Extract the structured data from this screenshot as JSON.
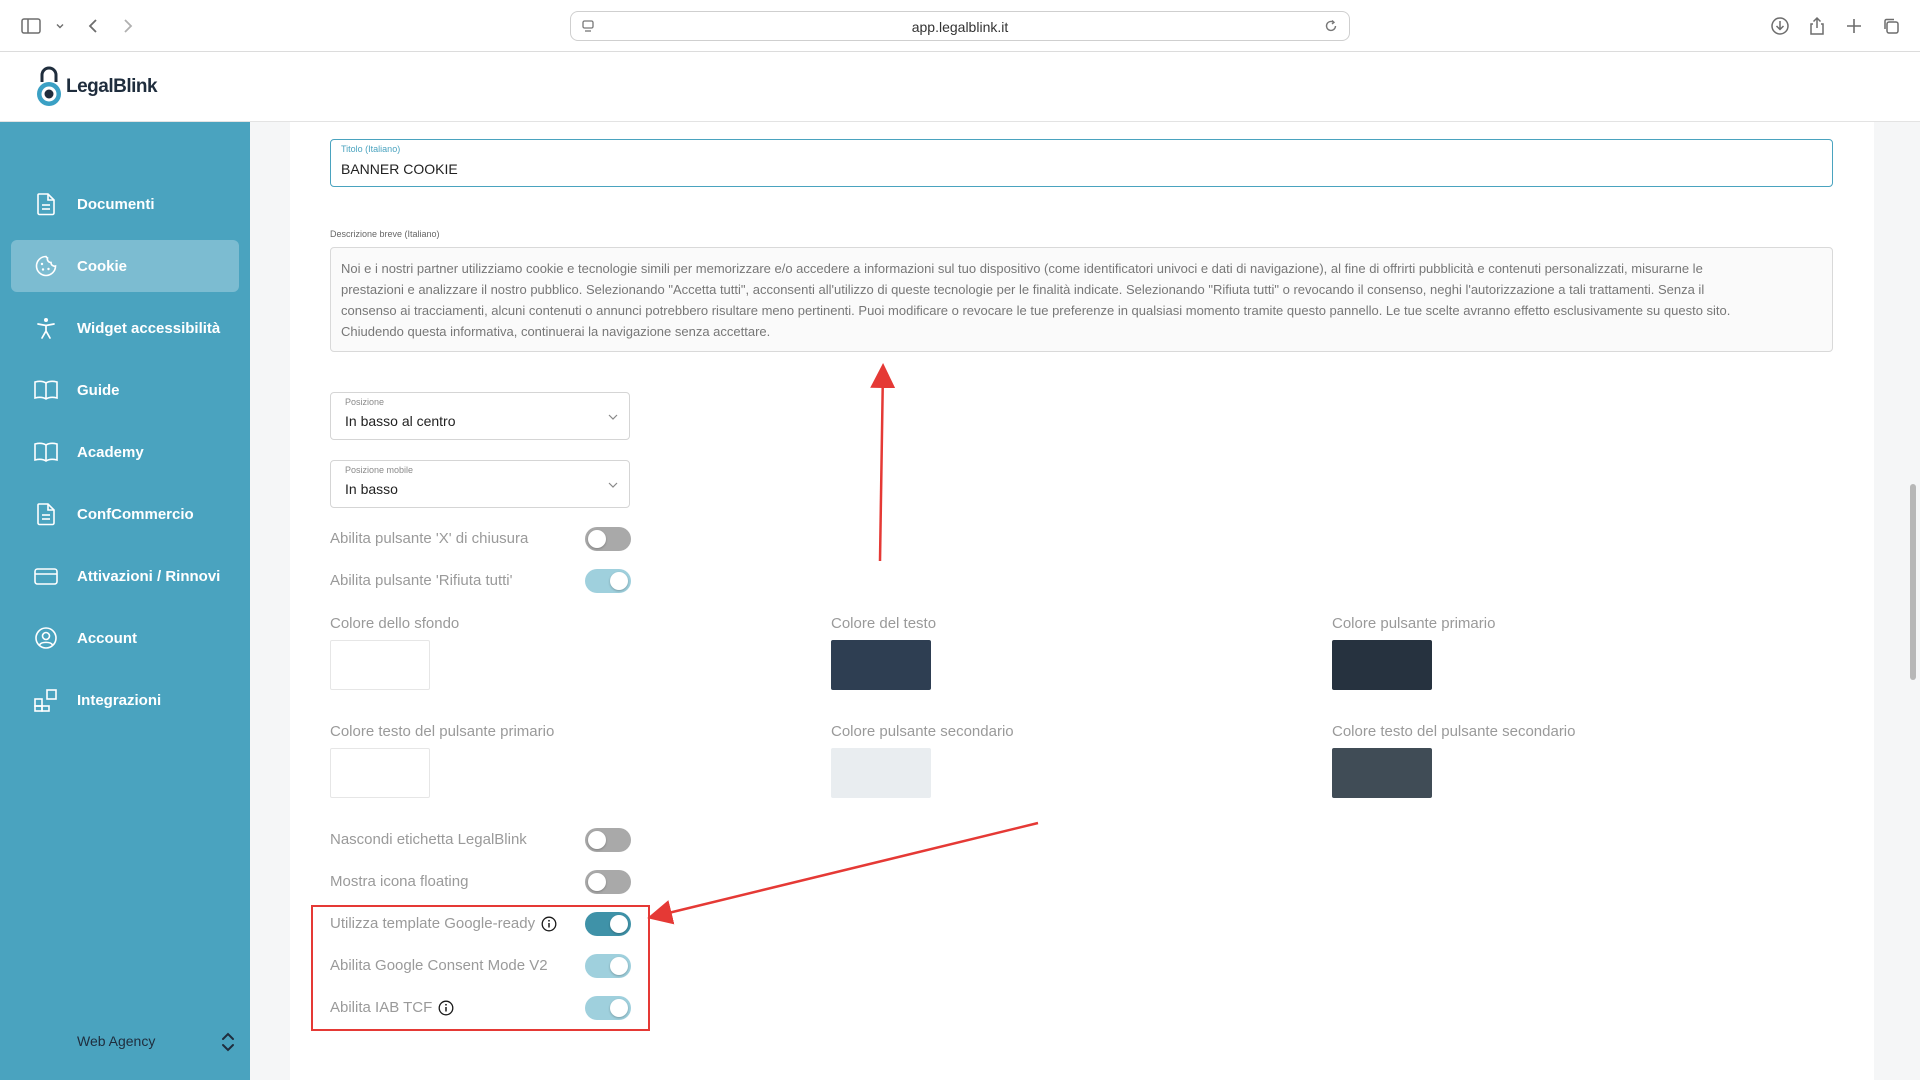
{
  "browser": {
    "url": "app.legalblink.it"
  },
  "app": {
    "logo_text": "LegalBlink"
  },
  "sidebar": {
    "items": [
      {
        "label": "Documenti",
        "icon": "document-icon",
        "active": false
      },
      {
        "label": "Cookie",
        "icon": "cookie-icon",
        "active": true
      },
      {
        "label": "Widget accessibilità",
        "icon": "accessibility-icon",
        "active": false
      },
      {
        "label": "Guide",
        "icon": "book-icon",
        "active": false
      },
      {
        "label": "Academy",
        "icon": "book-icon",
        "active": false
      },
      {
        "label": "ConfCommercio",
        "icon": "document-icon",
        "active": false
      },
      {
        "label": "Attivazioni / Rinnovi",
        "icon": "card-icon",
        "active": false
      },
      {
        "label": "Account",
        "icon": "user-circle-icon",
        "active": false
      },
      {
        "label": "Integrazioni",
        "icon": "integrations-icon",
        "active": false
      }
    ],
    "agency": "Web Agency"
  },
  "form": {
    "title_label": "Titolo (Italiano)",
    "title_value": "BANNER COOKIE",
    "description_label": "Descrizione breve (Italiano)",
    "description_lines": [
      "Noi e i nostri partner utilizziamo cookie e tecnologie simili per memorizzare e/o accedere a informazioni sul tuo dispositivo (come identificatori univoci e dati di navigazione), al fine di offrirti pubblicità e contenuti personalizzati, misurarne le",
      "prestazioni e analizzare il nostro pubblico. Selezionando \"Accetta tutti\", acconsenti all'utilizzo di queste tecnologie per le finalità indicate. Selezionando \"Rifiuta tutti\" o revocando il consenso, neghi l'autorizzazione a tali trattamenti. Senza il",
      "consenso ai tracciamenti, alcuni contenuti o annunci potrebbero risultare meno pertinenti. Puoi modificare o revocare le tue preferenze in qualsiasi momento tramite questo pannello. Le tue scelte avranno effetto esclusivamente su questo sito.",
      "Chiudendo questa informativa, continuerai la navigazione senza accettare."
    ],
    "position": {
      "label": "Posizione",
      "value": "In basso al centro"
    },
    "position_mobile": {
      "label": "Posizione mobile",
      "value": "In basso"
    },
    "toggles_top": [
      {
        "label": "Abilita pulsante 'X' di chiusura",
        "state": "off"
      },
      {
        "label": "Abilita pulsante 'Rifiuta tutti'",
        "state": "on"
      }
    ],
    "colors": [
      {
        "label": "Colore dello sfondo",
        "value": "#ffffff"
      },
      {
        "label": "Colore del testo",
        "value": "#2e3e52"
      },
      {
        "label": "Colore pulsante primario",
        "value": "#26323f"
      },
      {
        "label": "Colore testo del pulsante primario",
        "value": "#ffffff"
      },
      {
        "label": "Colore pulsante secondario",
        "value": "#e9edf0"
      },
      {
        "label": "Colore testo del pulsante secondario",
        "value": "#404c56"
      }
    ],
    "toggles_bottom": [
      {
        "label": "Nascondi etichetta LegalBlink",
        "state": "off"
      },
      {
        "label": "Mostra icona floating",
        "state": "off"
      },
      {
        "label": "Utilizza template Google-ready",
        "state": "on",
        "info": true
      },
      {
        "label": "Abilita Google Consent Mode V2",
        "state": "on"
      },
      {
        "label": "Abilita IAB TCF",
        "state": "on",
        "info": true
      }
    ]
  },
  "colors": {
    "sidebar_bg": "#4aa3bf",
    "accent": "#4aa3bf",
    "toggle_on": "#3f92a8",
    "annotation": "#e53935"
  }
}
